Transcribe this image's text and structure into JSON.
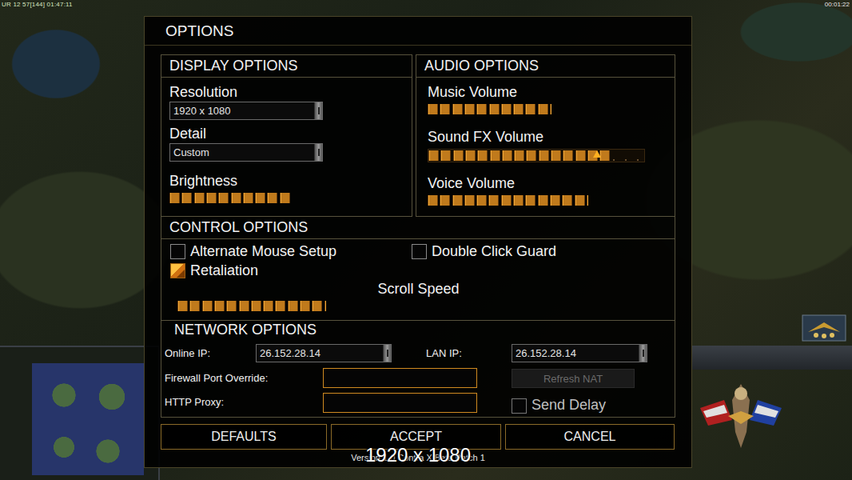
{
  "hud": {
    "top_left": "UR 12 57[144] 01:47:11",
    "top_right": "00:01:22"
  },
  "window": {
    "title": "OPTIONS"
  },
  "display": {
    "title": "DISPLAY OPTIONS",
    "fields": [
      {
        "kind": "dropdown",
        "label": "Resolution",
        "value": "1920 x 1080"
      },
      {
        "kind": "dropdown",
        "label": "Detail",
        "value": "Custom"
      },
      {
        "kind": "slider",
        "label": "Brightness",
        "level": 0.63,
        "hovered": false
      }
    ]
  },
  "audio": {
    "title": "AUDIO OPTIONS",
    "sliders": [
      {
        "label": "Music Volume",
        "level": 0.57,
        "hovered": false
      },
      {
        "label": "Sound FX Volume",
        "level": 0.85,
        "hovered": true
      },
      {
        "label": "Voice Volume",
        "level": 0.74,
        "hovered": false
      }
    ]
  },
  "controls": {
    "title": "CONTROL OPTIONS",
    "checkboxes": [
      {
        "label": "Alternate Mouse Setup",
        "checked": false
      },
      {
        "label": "Double Click Guard",
        "checked": false
      },
      {
        "label": "Retaliation",
        "checked": true
      }
    ],
    "scroll": {
      "label": "Scroll Speed",
      "level": 0.62
    }
  },
  "network": {
    "title": "NETWORK OPTIONS",
    "online_ip": {
      "label": "Online IP:",
      "value": "26.152.28.14"
    },
    "lan_ip": {
      "label": "LAN IP:",
      "value": "26.152.28.14"
    },
    "firewall": {
      "label": "Firewall Port Override:",
      "value": ""
    },
    "proxy": {
      "label": "HTTP Proxy:",
      "value": ""
    },
    "refresh_nat": {
      "label": "Refresh NAT",
      "disabled": true
    },
    "send_delay": {
      "label": "Send Delay",
      "checked": false,
      "disabled": true
    }
  },
  "buttons": [
    "DEFAULTS",
    "ACCEPT",
    "CANCEL"
  ],
  "version": "Version 1.0 Contra X Beta Patch 1",
  "overlay": "1920 x 1080"
}
